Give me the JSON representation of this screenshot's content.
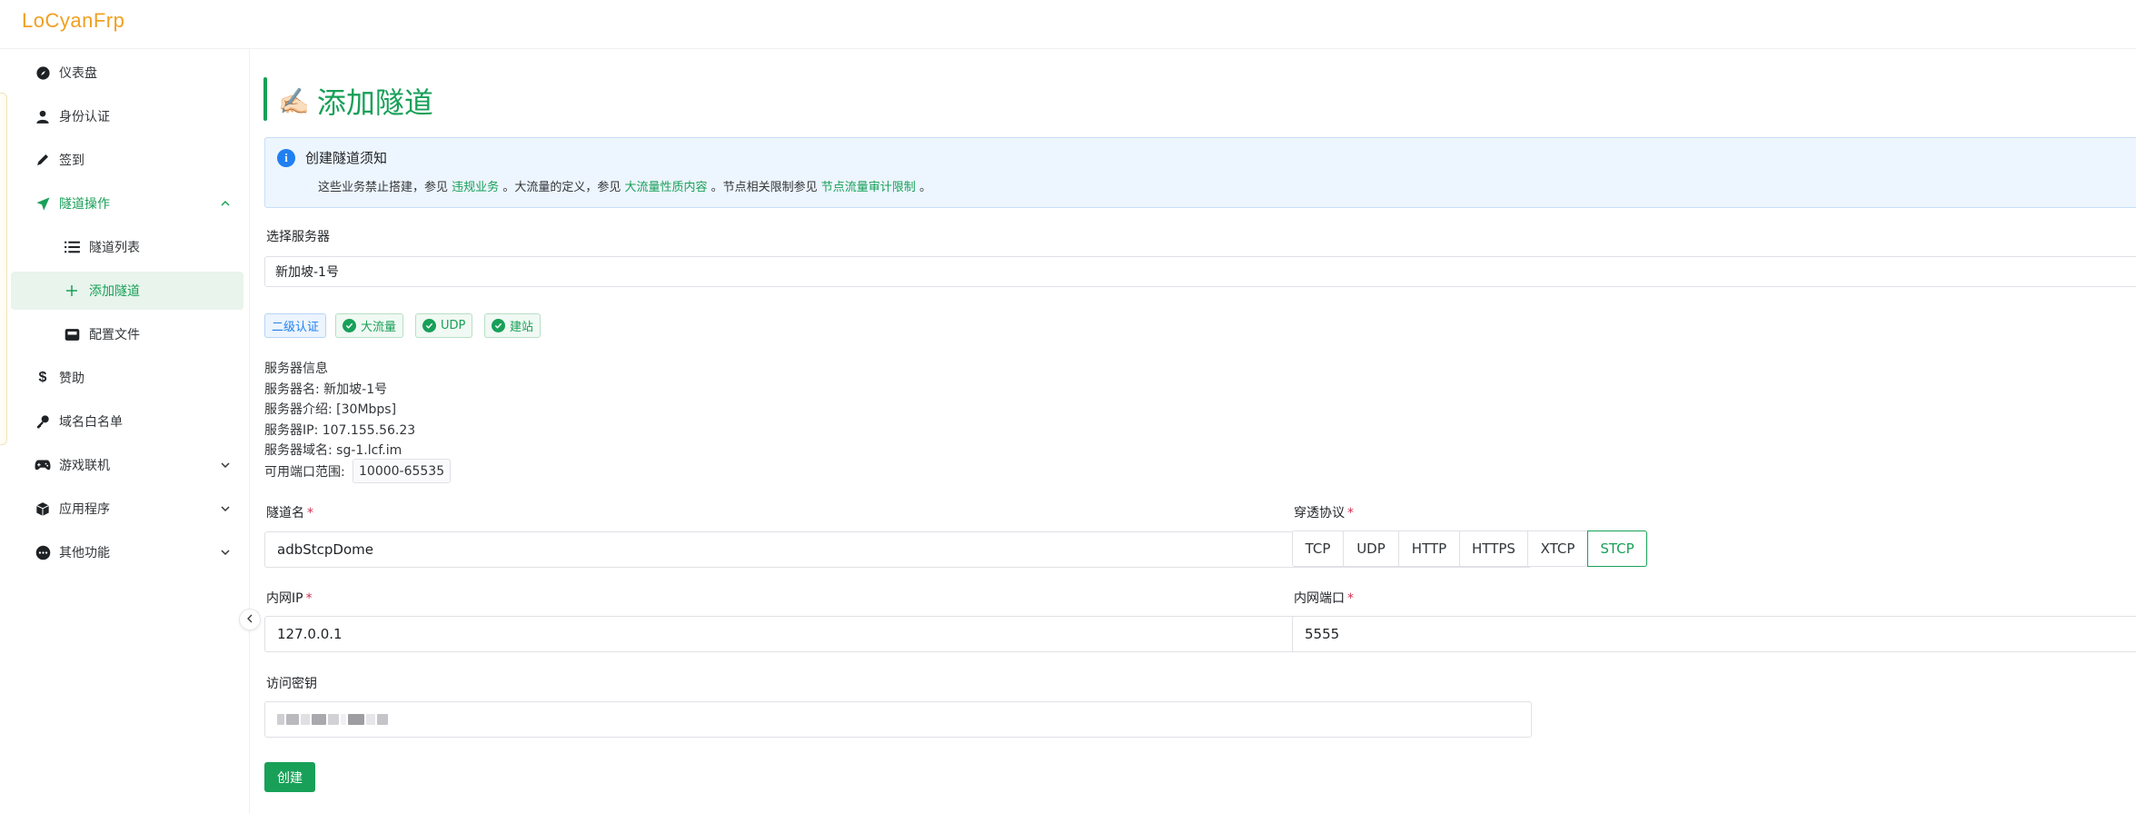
{
  "app": {
    "logo": "LoCyanFrp"
  },
  "sidebar": {
    "items": [
      {
        "label": "仪表盘",
        "icon": "compass-icon"
      },
      {
        "label": "身份认证",
        "icon": "user-icon"
      },
      {
        "label": "签到",
        "icon": "pen-icon"
      },
      {
        "label": "隧道操作",
        "icon": "paper-plane-icon",
        "expanded": true
      },
      {
        "label": "隧道列表",
        "icon": "list-icon"
      },
      {
        "label": "添加隧道",
        "icon": "plus-icon",
        "active": true
      },
      {
        "label": "配置文件",
        "icon": "file-box-icon"
      },
      {
        "label": "赞助",
        "icon": "dollar-icon"
      },
      {
        "label": "域名白名单",
        "icon": "key-icon"
      },
      {
        "label": "游戏联机",
        "icon": "gamepad-icon"
      },
      {
        "label": "应用程序",
        "icon": "cube-icon"
      },
      {
        "label": "其他功能",
        "icon": "more-icon"
      }
    ]
  },
  "page": {
    "title_emoji": "✍🏻",
    "title": "添加隧道"
  },
  "notice": {
    "title": "创建隧道须知",
    "t1": "这些业务禁止搭建，参见",
    "link1": "违规业务",
    "t2": "。大流量的定义，参见",
    "link2": "大流量性质内容",
    "t3": "。节点相关限制参见",
    "link3": "节点流量审计限制",
    "t4": "。"
  },
  "server_select": {
    "label": "选择服务器",
    "value": "新加坡-1号"
  },
  "tags": [
    "二级认证",
    "大流量",
    "UDP",
    "建站"
  ],
  "server_info": {
    "heading": "服务器信息",
    "name": "服务器名: 新加坡-1号",
    "intro": "服务器介绍: [30Mbps]",
    "ip": "服务器IP: 107.155.56.23",
    "domain": "服务器域名: sg-1.lcf.im",
    "port_label": "可用端口范围:",
    "port_range": "10000-65535"
  },
  "form": {
    "tunnel_name_label": "隧道名",
    "tunnel_name": "adbStcpDome",
    "protocol_label": "穿透协议",
    "protocols": [
      "TCP",
      "UDP",
      "HTTP",
      "HTTPS",
      "XTCP",
      "STCP"
    ],
    "selected_protocol": "STCP",
    "local_ip_label": "内网IP",
    "local_ip": "127.0.0.1",
    "local_port_label": "内网端口",
    "local_port": "5555",
    "secret_label": "访问密钥",
    "required_mark": "*",
    "create_label": "创建"
  },
  "colors": {
    "primary": "#18a058",
    "info": "#2080f0",
    "logo": "#f0a020",
    "required": "#d03050"
  }
}
